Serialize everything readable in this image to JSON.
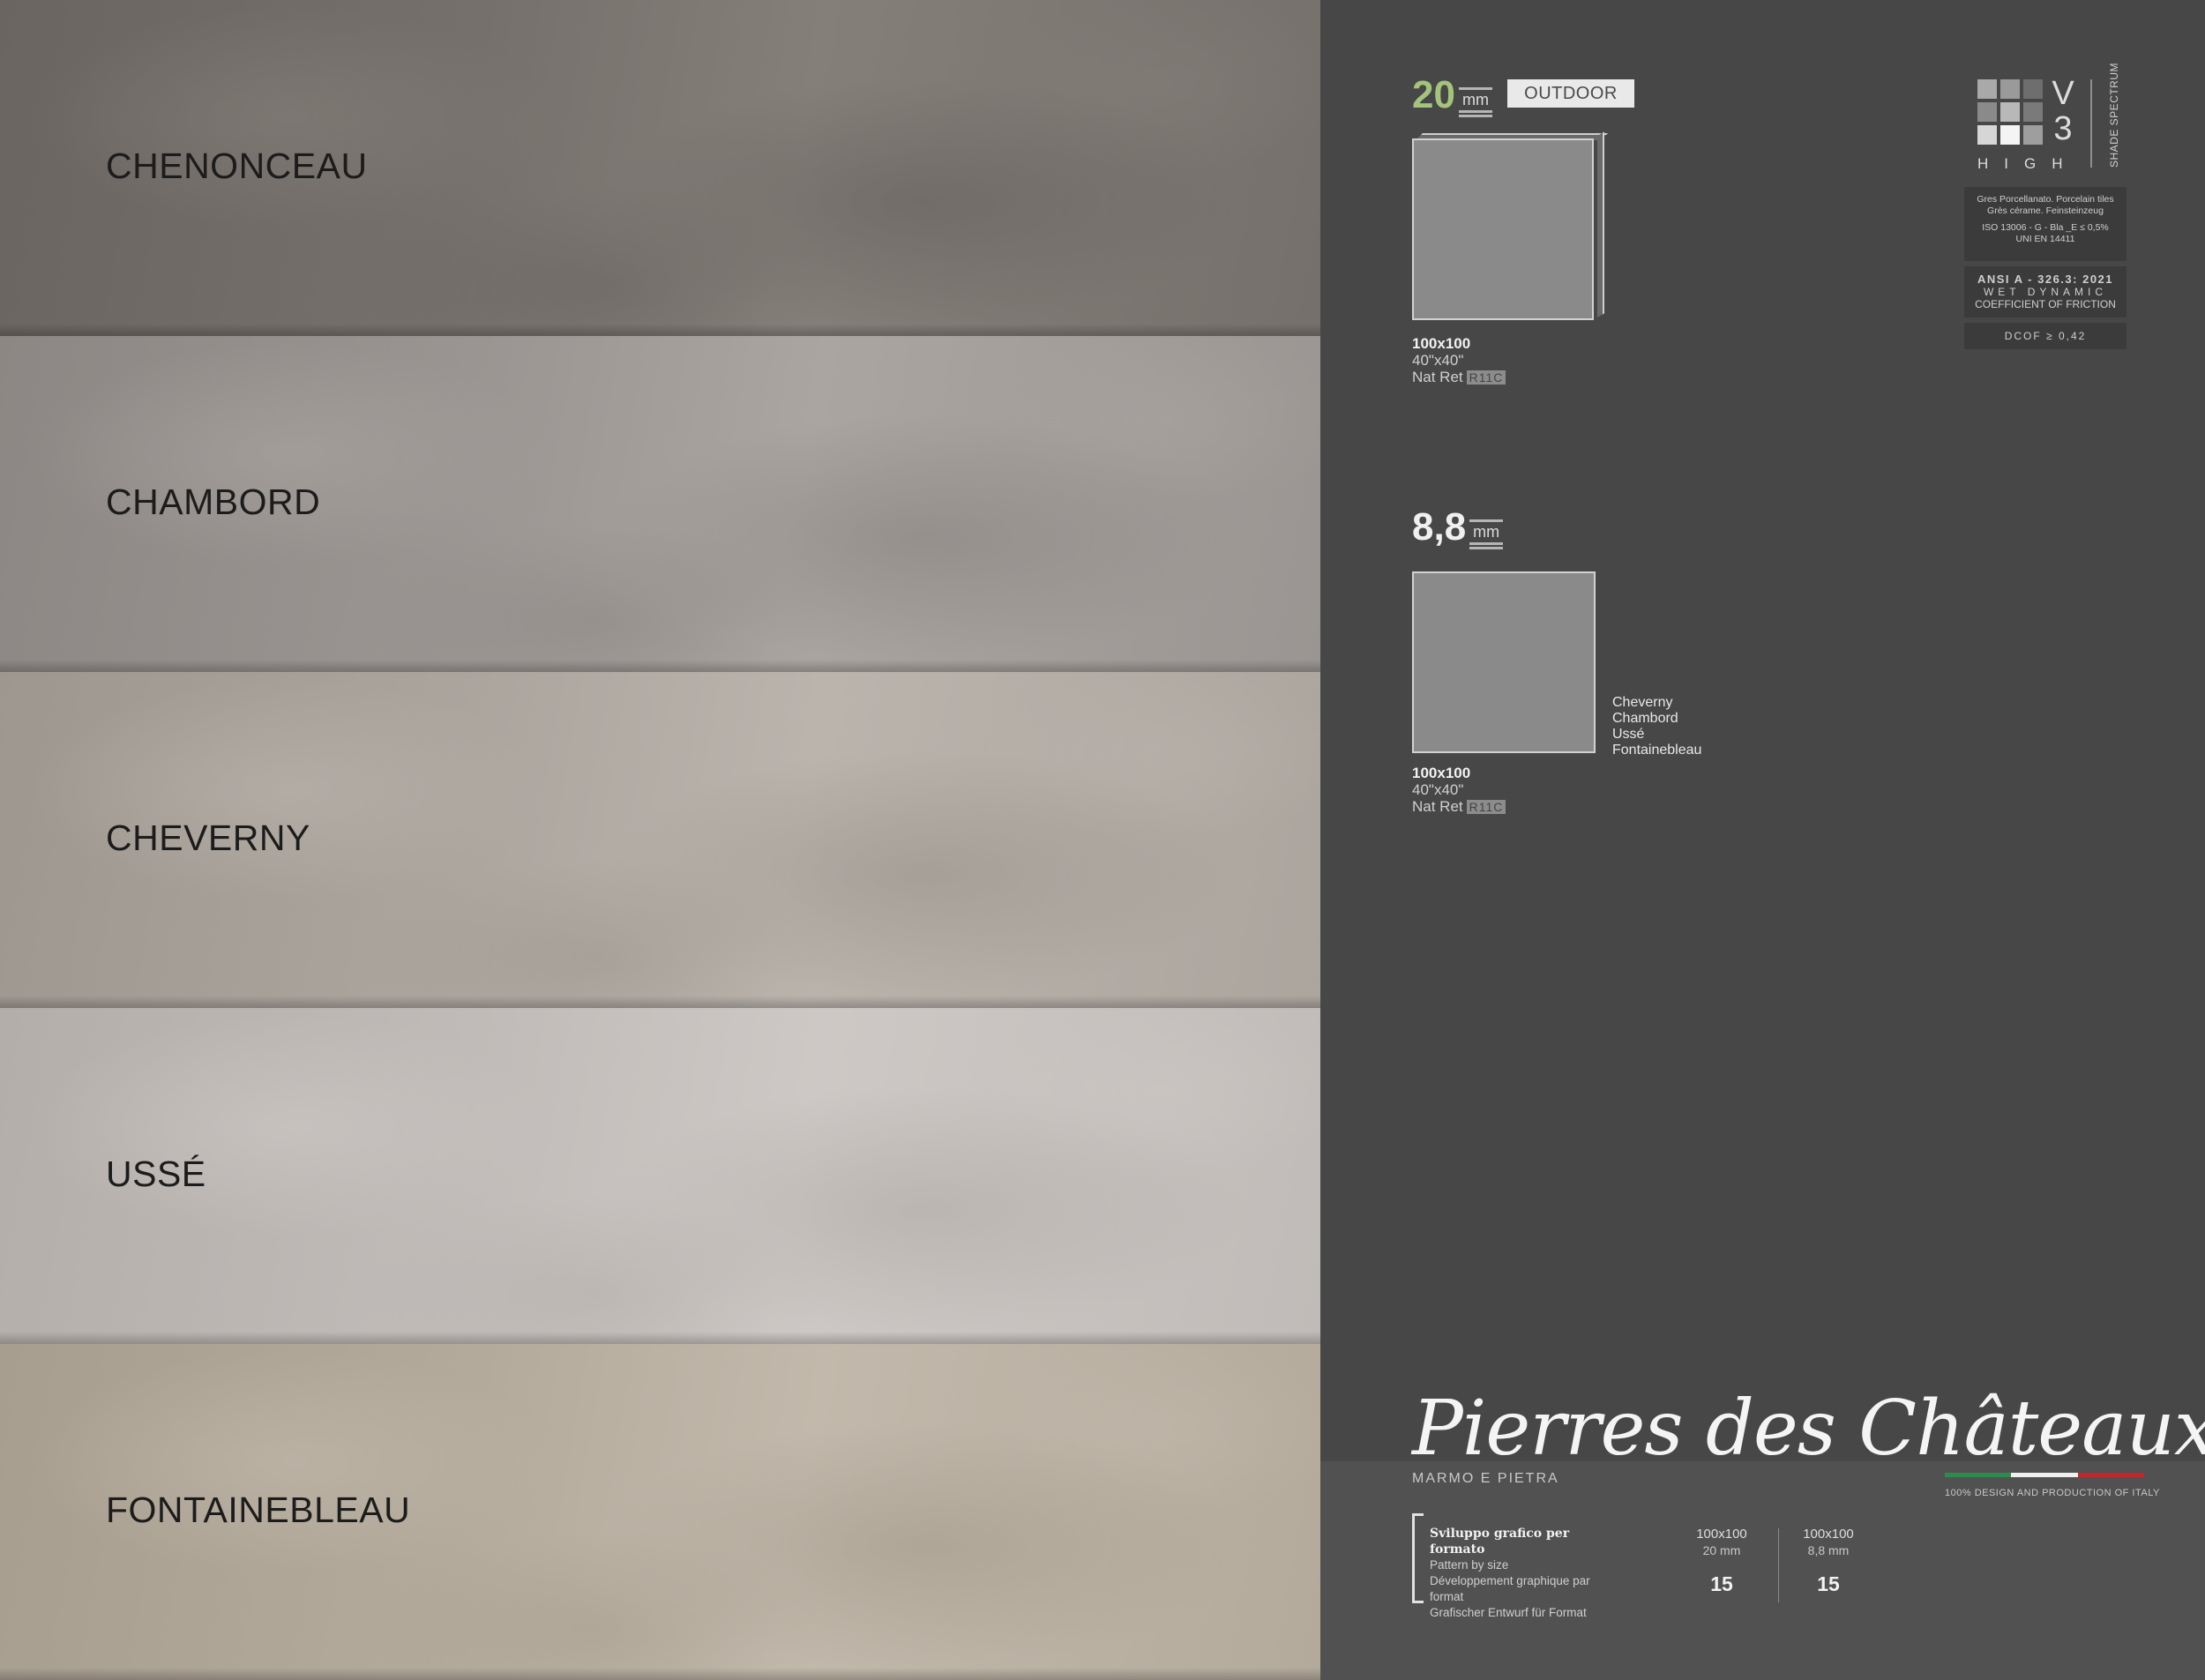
{
  "swatches": [
    {
      "name": "CHENONCEAU",
      "base": "#75706b",
      "mid": "#6a6561",
      "light": "#857f79"
    },
    {
      "name": "CHAMBORD",
      "base": "#9a9592",
      "mid": "#8c8784",
      "light": "#aaa5a1"
    },
    {
      "name": "CHEVERNY",
      "base": "#aba59e",
      "mid": "#9d978f",
      "light": "#bab4ad"
    },
    {
      "name": "USSÉ",
      "base": "#c0bbb8",
      "mid": "#b3aeaa",
      "light": "#cdc8c5"
    },
    {
      "name": "FONTAINEBLEAU",
      "base": "#b4aa9c",
      "mid": "#a89e90",
      "light": "#c2b8ab"
    }
  ],
  "panel": {
    "format1": {
      "thickness": "20",
      "unit": "mm",
      "badge": "OUTDOOR",
      "size": "100x100",
      "inches": "40\"x40\"",
      "finish": "Nat Ret",
      "slip": "R11C"
    },
    "format2": {
      "thickness": "8,8",
      "unit": "mm",
      "size": "100x100",
      "inches": "40\"x40\"",
      "finish": "Nat Ret",
      "slip": "R11C",
      "shades": [
        "Cheverny",
        "Chambord",
        "Ussé",
        "Fontainebleau"
      ]
    },
    "shade": {
      "v": "V",
      "level": "3",
      "label": "HIGH",
      "spectrum": "SHADE SPECTRUM",
      "grid_colors": [
        "#a9a9a9",
        "#9a9a9a",
        "#6e6e6e",
        "#8a8a8a",
        "#b8b8b8",
        "#7a7a7a",
        "#d6d6d6",
        "#f4f4f4",
        "#9e9e9e"
      ]
    },
    "cert": {
      "line1": "Gres Porcellanato. Porcelain tiles",
      "line2": "Grès cérame. Feinsteinzeug",
      "line3": "ISO 13006 - G - Bla _E ≤ 0,5%",
      "line4": "UNI EN 14411",
      "ansi": "ANSI A - 326.3: 2021",
      "wet": "WET DYNAMIC",
      "cof": "COEFFICIENT OF FRICTION",
      "dcof": "DCOF ≥ 0,42"
    },
    "brand": {
      "title": "Pierres des Châteaux",
      "subtitle": "MARMO E PIETRA",
      "made": "100% DESIGN AND PRODUCTION OF ITALY",
      "flag": [
        "#2e8b4e",
        "#f0f0f0",
        "#c0282d"
      ]
    },
    "pattern": {
      "title": "Sviluppo grafico per formato",
      "en": "Pattern by size",
      "fr": "Développement graphique par format",
      "de": "Grafischer Entwurf für Format",
      "formats": [
        {
          "size": "100x100",
          "thick": "20 mm",
          "count": "15"
        },
        {
          "size": "100x100",
          "thick": "8,8 mm",
          "count": "15"
        }
      ]
    }
  }
}
